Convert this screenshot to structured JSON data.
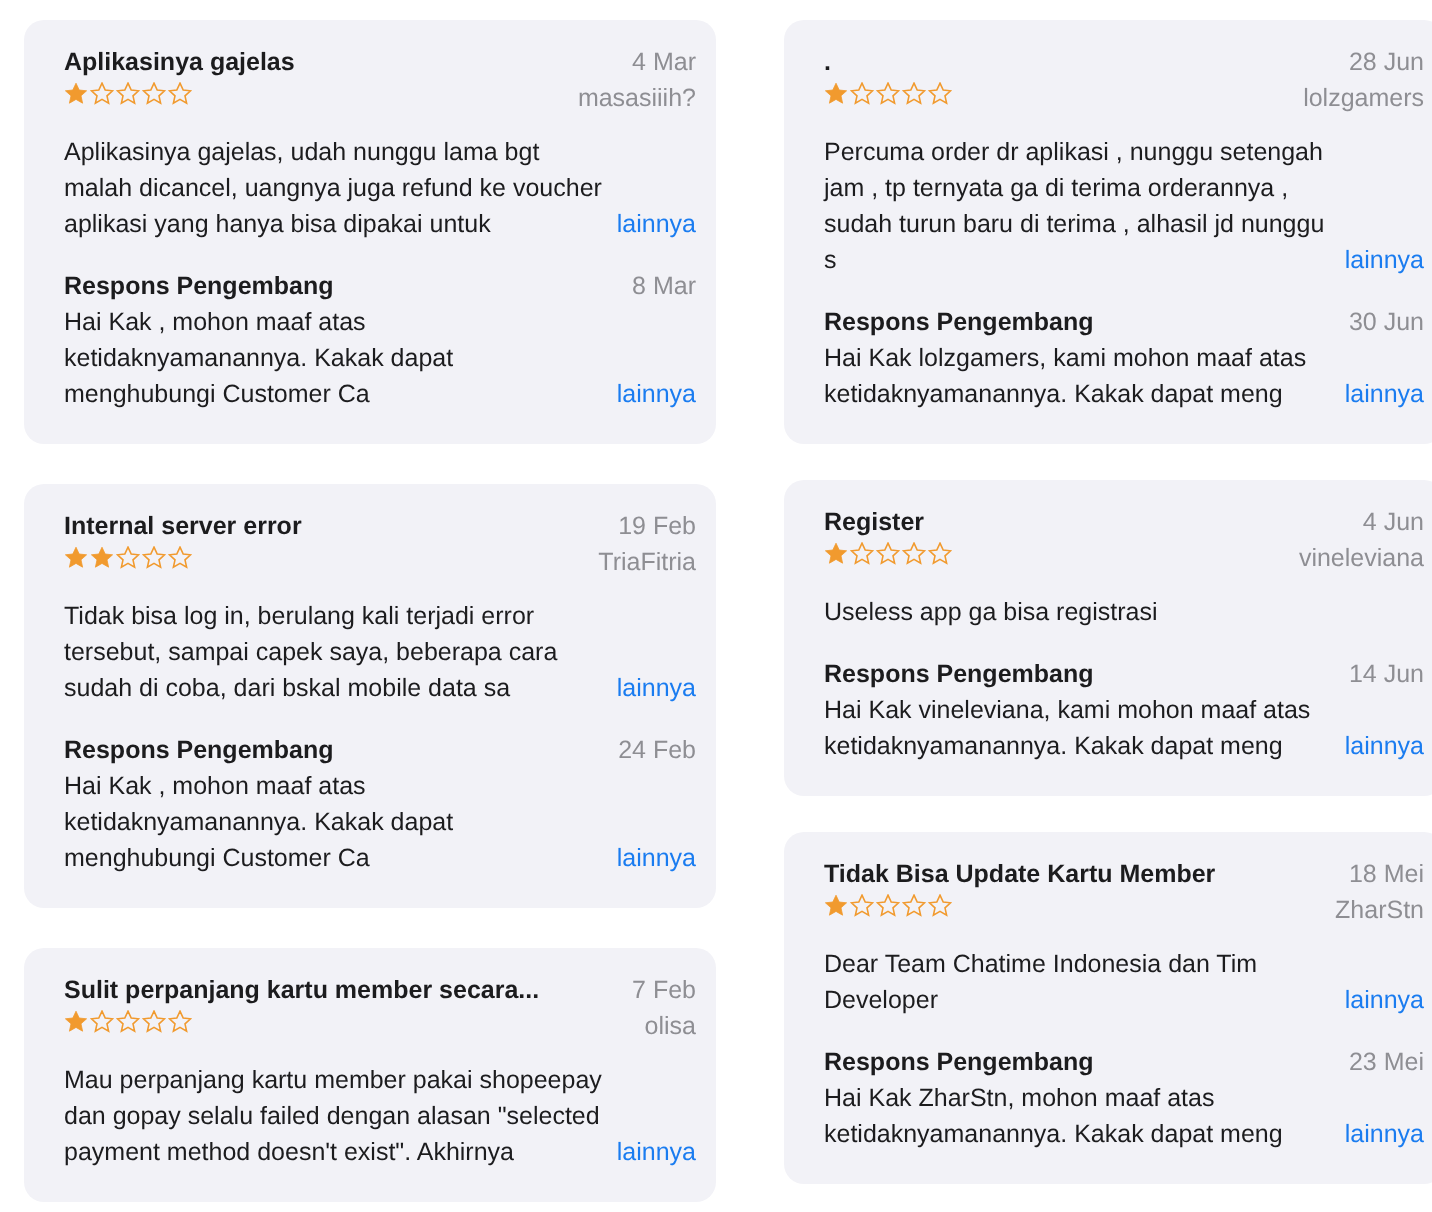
{
  "columns": [
    {
      "reviews": [
        {
          "title": "Aplikasinya gajelas",
          "date": "4 Mar",
          "stars": 1,
          "author": "masasiiih?",
          "body": "Aplikasinya gajelas, udah nunggu lama bgt malah dicancel, uangnya juga refund ke voucher aplikasi yang hanya bisa dipakai untuk",
          "more": "lainnya",
          "response": {
            "label": "Respons Pengembang",
            "date": "8 Mar",
            "text": "Hai Kak , mohon maaf atas ketidaknyamanannya. Kakak dapat menghubungi Customer Ca",
            "more": "lainnya"
          }
        },
        {
          "title": "Internal server error",
          "date": "19 Feb",
          "stars": 2,
          "author": "TriaFitria",
          "body": "Tidak bisa log in, berulang kali terjadi error tersebut, sampai capek saya, beberapa cara sudah di coba, dari bskal mobile data sa",
          "more": "lainnya",
          "response": {
            "label": "Respons Pengembang",
            "date": "24 Feb",
            "text": "Hai Kak , mohon maaf atas ketidaknyamanannya. Kakak dapat menghubungi Customer Ca",
            "more": "lainnya"
          }
        },
        {
          "title": "Sulit perpanjang kartu member secara...",
          "date": "7 Feb",
          "stars": 1,
          "author": "olisa",
          "body": "Mau perpanjang kartu member pakai shopeepay dan gopay selalu failed dengan alasan \"selected payment method doesn't exist\". Akhirnya",
          "more": "lainnya"
        }
      ]
    },
    {
      "reviews": [
        {
          "title": ".",
          "date": "28 Jun",
          "stars": 1,
          "author": "lolzgamers",
          "body": "Percuma order dr aplikasi , nunggu setengah jam , tp ternyata ga di terima orderannya , sudah turun baru di terima , alhasil jd nunggu s",
          "more": "lainnya",
          "response": {
            "label": "Respons Pengembang",
            "date": "30 Jun",
            "text": "Hai Kak lolzgamers, kami mohon maaf atas ketidaknyamanannya. Kakak dapat meng",
            "more": "lainnya"
          }
        },
        {
          "title": "Register",
          "date": "4 Jun",
          "stars": 1,
          "author": "vineleviana",
          "body": "Useless app ga bisa registrasi",
          "response": {
            "label": "Respons Pengembang",
            "date": "14 Jun",
            "text": "Hai Kak vineleviana, kami mohon maaf atas ketidaknyamanannya. Kakak dapat meng",
            "more": "lainnya"
          }
        },
        {
          "title": "Tidak Bisa Update Kartu Member",
          "date": "18 Mei",
          "stars": 1,
          "author": "ZharStn",
          "body": "Dear Team Chatime Indonesia dan Tim Developer",
          "more": "lainnya",
          "response": {
            "label": "Respons Pengembang",
            "date": "23 Mei",
            "text": "Hai Kak ZharStn, mohon maaf atas ketidaknyamanannya. Kakak dapat meng",
            "more": "lainnya"
          }
        }
      ]
    }
  ]
}
